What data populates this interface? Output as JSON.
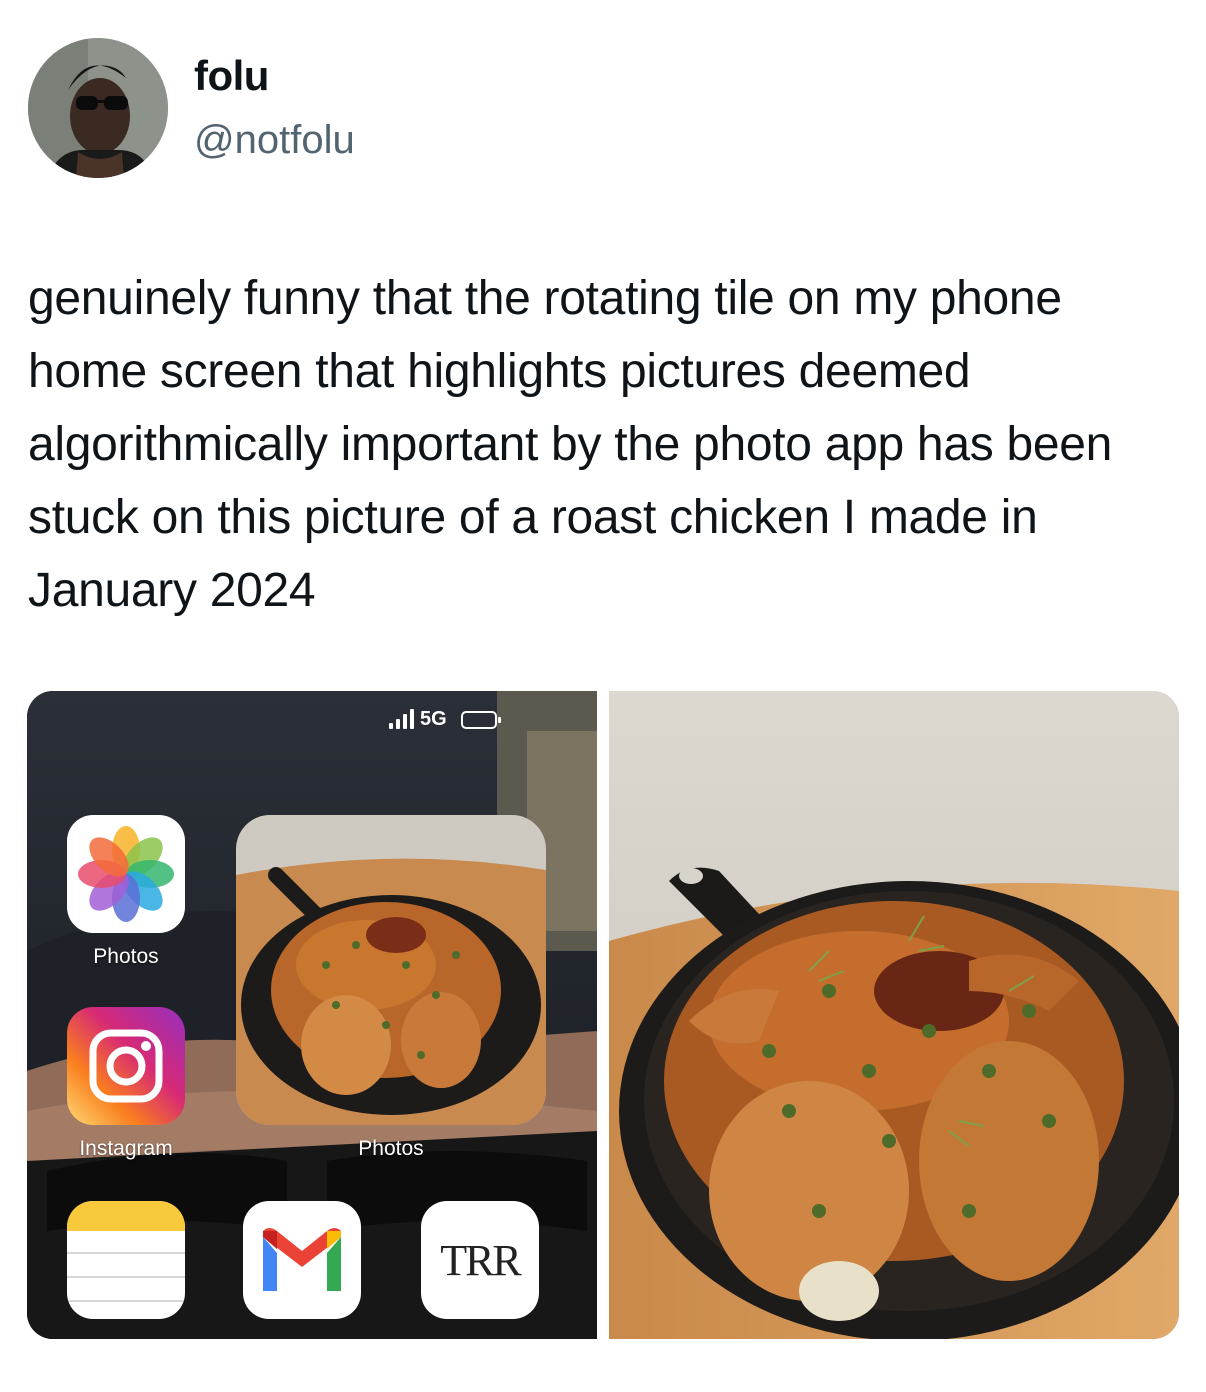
{
  "author": {
    "name": "folu",
    "handle": "@notfolu"
  },
  "tweet": {
    "text": "genuinely funny that the rotating tile on my phone home screen that highlights pictures deemed algorithmically important by the photo app has been stuck on this picture of a roast chicken I made in January 2024"
  },
  "phone_screenshot": {
    "status_bar": {
      "network": "5G"
    },
    "apps": {
      "photos_label": "Photos",
      "instagram_label": "Instagram",
      "widget_label": "Photos",
      "trr_icon_text": "TRR"
    }
  }
}
